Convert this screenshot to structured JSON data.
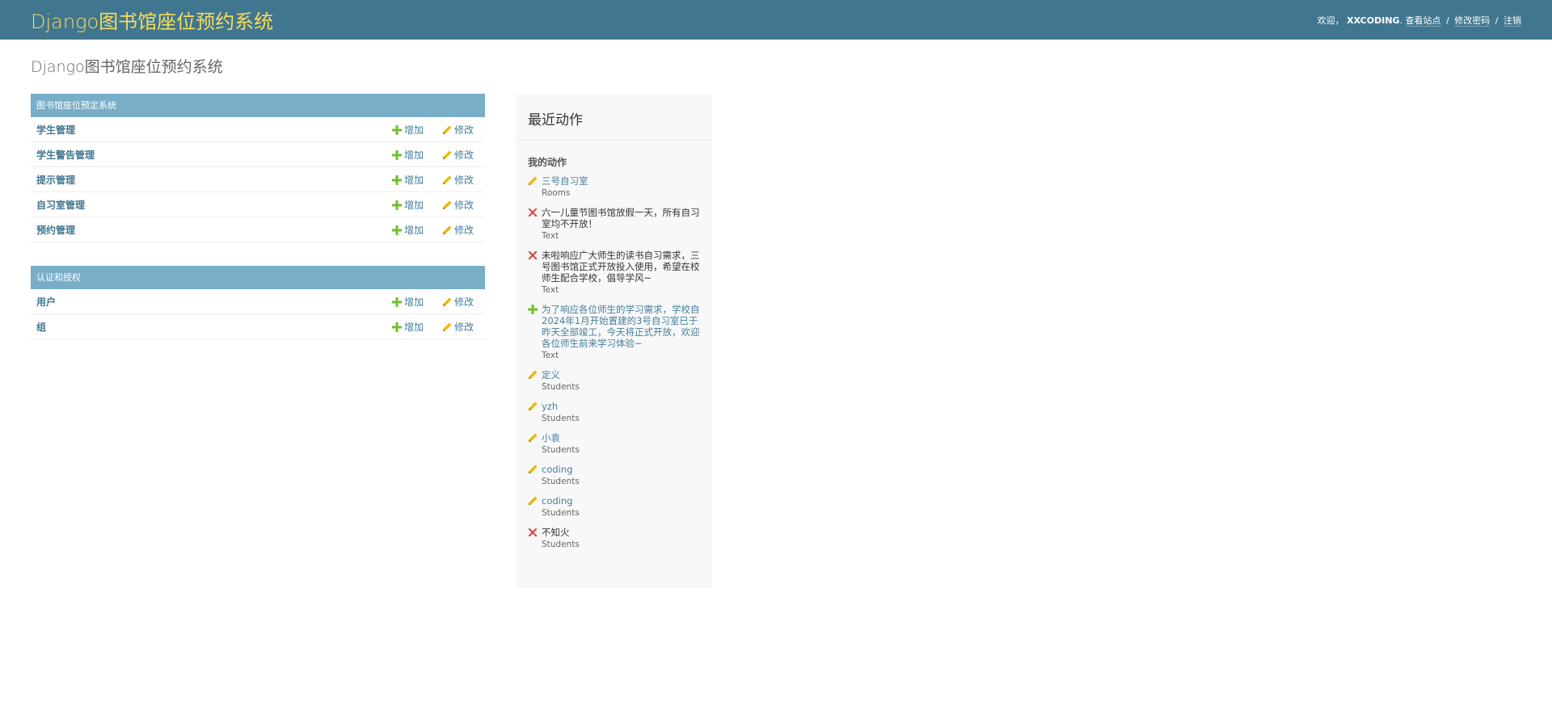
{
  "header": {
    "site_name": "Django图书馆座位预约系统",
    "welcome": "欢迎，",
    "username": "XXCODING",
    "view_site": "查看站点",
    "change_password": "修改密码",
    "logout": "注销",
    "separator": "/"
  },
  "page": {
    "title": "Django图书馆座位预约系统"
  },
  "apps": [
    {
      "caption": "图书馆座位预定系统",
      "models": [
        {
          "name": "学生管理",
          "add": "增加",
          "change": "修改"
        },
        {
          "name": "学生警告管理",
          "add": "增加",
          "change": "修改"
        },
        {
          "name": "提示管理",
          "add": "增加",
          "change": "修改"
        },
        {
          "name": "自习室管理",
          "add": "增加",
          "change": "修改"
        },
        {
          "name": "预约管理",
          "add": "增加",
          "change": "修改"
        }
      ]
    },
    {
      "caption": "认证和授权",
      "models": [
        {
          "name": "用户",
          "add": "增加",
          "change": "修改"
        },
        {
          "name": "组",
          "add": "增加",
          "change": "修改"
        }
      ]
    }
  ],
  "recent_actions": {
    "title": "最近动作",
    "subtitle": "我的动作",
    "items": [
      {
        "icon": "pencil-icon",
        "title": "三号自习室",
        "type": "Rooms",
        "deleted": false
      },
      {
        "icon": "delete-x-icon",
        "title": "六一儿童节图书馆放假一天，所有自习室均不开放！",
        "type": "Text",
        "deleted": true
      },
      {
        "icon": "delete-x-icon",
        "title": "未啦响应广大师生的读书自习需求，三号图书馆正式开放投入使用，希望在校师生配合学校，倡导学风~",
        "type": "Text",
        "deleted": true
      },
      {
        "icon": "plus-icon",
        "title": "为了响应各位师生的学习需求，学校自2024年1月开始置建的3号自习室已于昨天全部竣工，今天将正式开放，欢迎各位师生前来学习体验~",
        "type": "Text",
        "deleted": false
      },
      {
        "icon": "pencil-icon",
        "title": "定义",
        "type": "Students",
        "deleted": false
      },
      {
        "icon": "pencil-icon",
        "title": "yzh",
        "type": "Students",
        "deleted": false
      },
      {
        "icon": "pencil-icon",
        "title": "小袁",
        "type": "Students",
        "deleted": false
      },
      {
        "icon": "pencil-icon",
        "title": "coding",
        "type": "Students",
        "deleted": false
      },
      {
        "icon": "pencil-icon",
        "title": "coding",
        "type": "Students",
        "deleted": false
      },
      {
        "icon": "delete-x-icon",
        "title": "不知火",
        "type": "Students",
        "deleted": true
      }
    ]
  },
  "colors": {
    "header_bg": "#417690",
    "brand_yellow": "#f5dd5d",
    "module_caption_bg": "#79aec8",
    "link_blue": "#447e9b",
    "add_green": "#70bf2b",
    "change_yellow": "#efb80b",
    "delete_red": "#dd4646"
  }
}
